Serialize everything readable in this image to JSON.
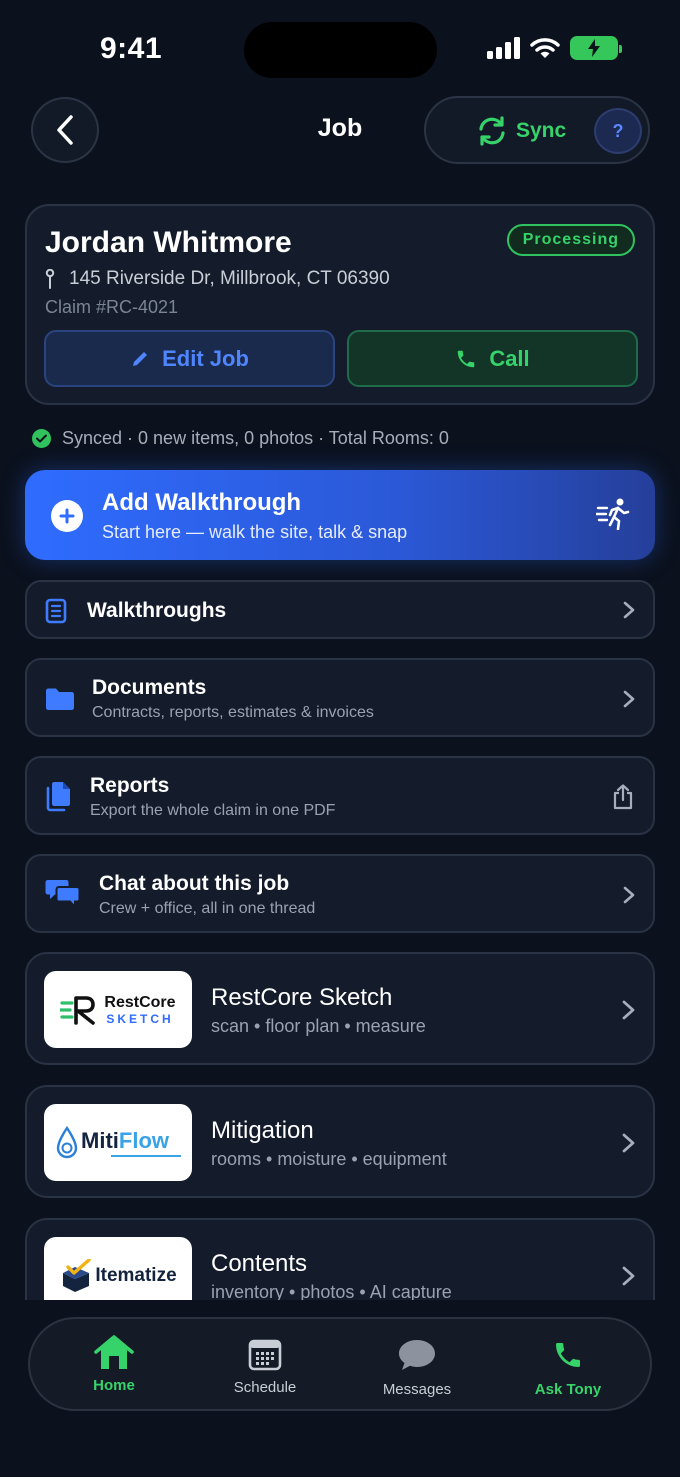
{
  "status_bar": {
    "time": "9:41"
  },
  "header": {
    "title": "Job",
    "sync_label": "Sync",
    "help_label": "?"
  },
  "job": {
    "customer_name": "Jordan Whitmore",
    "status": "Processing",
    "address": "145 Riverside Dr, Millbrook, CT 06390",
    "claim": "Claim #RC-4021",
    "edit_label": "Edit Job",
    "call_label": "Call"
  },
  "sync_status": "Synced · 0 new items, 0 photos · Total Rooms: 0",
  "add_walkthrough": {
    "title": "Add Walkthrough",
    "subtitle": "Start here — walk the site, talk & snap"
  },
  "menu": [
    {
      "title": "Walkthroughs",
      "subtitle": ""
    },
    {
      "title": "Documents",
      "subtitle": "Contracts, reports, estimates & invoices"
    },
    {
      "title": "Reports",
      "subtitle": "Export the whole claim in one PDF"
    },
    {
      "title": "Chat about this job",
      "subtitle": "Crew + office, all in one thread"
    }
  ],
  "apps": [
    {
      "logo_line1": "RestCore",
      "logo_line2": "SKETCH",
      "title": "RestCore Sketch",
      "subtitle": "scan • floor plan • measure"
    },
    {
      "logo_part1": "Miti",
      "logo_part2": "Flow",
      "title": "Mitigation",
      "subtitle": "rooms • moisture • equipment"
    },
    {
      "logo_text": "Itematize",
      "title": "Contents",
      "subtitle": "inventory • photos • AI capture"
    }
  ],
  "tabs": [
    {
      "label": "Home",
      "active": true
    },
    {
      "label": "Schedule",
      "active": false
    },
    {
      "label": "Messages",
      "active": false
    },
    {
      "label": "Ask Tony",
      "active": false
    }
  ],
  "colors": {
    "accent_blue": "#2f6cff",
    "accent_green": "#36d26a",
    "background": "#0b111d"
  }
}
